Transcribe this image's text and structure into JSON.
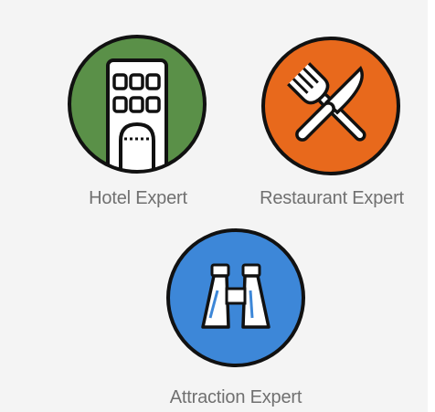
{
  "experts": [
    {
      "id": "hotel",
      "label": "Hotel Expert",
      "icon": "hotel-building-icon",
      "color": "#5a9048"
    },
    {
      "id": "restaurant",
      "label": "Restaurant Expert",
      "icon": "fork-knife-icon",
      "color": "#e8691c"
    },
    {
      "id": "attraction",
      "label": "Attraction Expert",
      "icon": "binoculars-icon",
      "color": "#3d87d8"
    }
  ]
}
